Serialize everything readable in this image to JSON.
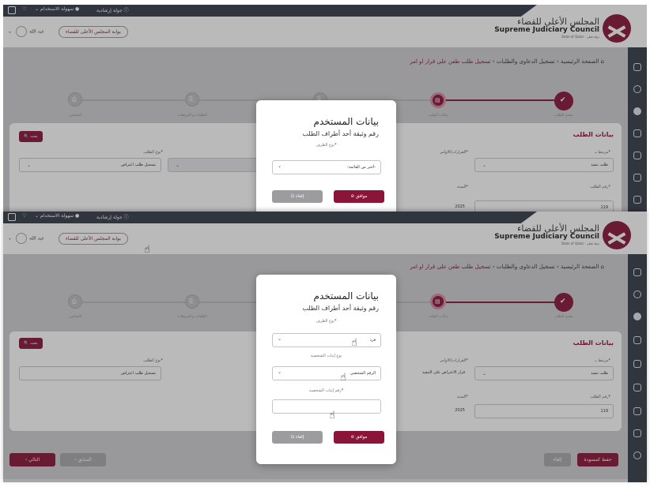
{
  "header": {
    "tour": "جولة إرشادية",
    "accessibility": "سهولة الاستخدام",
    "logo_ar": "المجلس الأعلى للقضاء",
    "logo_en": "Supreme Judiciary Council",
    "logo_sub": "State of Qatar - دولة قطر",
    "portal_link": "بوابة المجلس الأعلى للقضاء",
    "user_name": "عبد الله"
  },
  "breadcrumb": {
    "home": "الصفحة الرئيسية",
    "section": "تسجيل الدعاوى والطلبات",
    "current": "تسجيل طلب طعن على قرار او امر"
  },
  "steps": [
    "مقدم الطلب",
    "بيانات الطلب",
    "الطلبات و المرفقات",
    "المحامي"
  ],
  "request_card": {
    "title": "بيانات الطلب",
    "search": "بحث",
    "linked_label": "مرتبط بـ",
    "linked_value": "طلب تنفيذ",
    "decisions_label": "القرارات/الاوامر",
    "decisions_value": "قرار الاعتراض على التنفيذ",
    "request_type_label": "نوع الطلب",
    "request_type_value": "تسجيل طلب اعتراض",
    "number_label": "رقم الطلب",
    "number_value": "119",
    "year_label": "السنة",
    "year_value": "2025"
  },
  "modal1": {
    "title": "بيانات المستخدم",
    "subtitle": "رقم وثيقة أحد أطراف الطلب",
    "party_type_label": "نوع الطرف",
    "party_type_value": "-أختر من القائمة-",
    "ok": "موافق",
    "cancel": "إلغاء"
  },
  "modal2": {
    "title": "بيانات المستخدم",
    "subtitle": "رقم وثيقة أحد أطراف الطلب",
    "party_type_label": "نوع الطرف",
    "party_type_value": "فرد",
    "id_type_label": "نوع إثبات الشخصية",
    "id_type_value": "الرقم الشخصي",
    "id_number_label": "رقم إثبات الشخصية",
    "id_number_value": "",
    "ok": "موافق",
    "cancel": "إلغاء"
  },
  "footer": {
    "next": "التالي",
    "previous": "السابق",
    "cancel": "إلغاء",
    "save_draft": "حفظ كمسودة"
  },
  "colors": {
    "brand": "#8a1538",
    "rail": "#353c48"
  }
}
